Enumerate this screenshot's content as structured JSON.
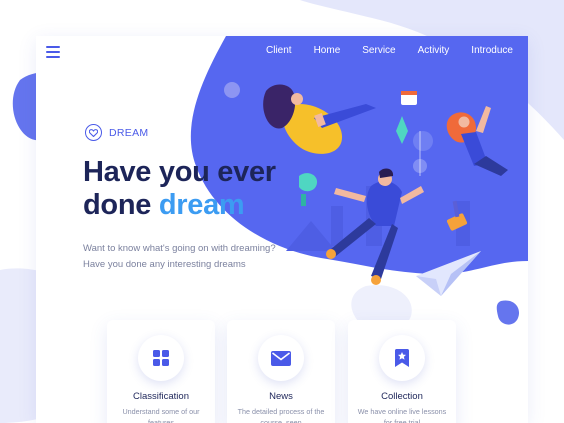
{
  "nav": {
    "menu_icon": "hamburger-menu-icon",
    "links": [
      "Client",
      "Home",
      "Service",
      "Activity",
      "Introduce"
    ]
  },
  "hero": {
    "brand_label": "DREAM",
    "brand_icon": "heart-circle-icon",
    "headline_line1": "Have you ever",
    "headline_line2_plain": "done ",
    "headline_line2_accent": "dream",
    "description": "Want to know what's going on with dreaming? Have you done any interesting dreams"
  },
  "features": [
    {
      "icon": "grid-icon",
      "title": "Classification",
      "desc": "Understand some of our features"
    },
    {
      "icon": "envelope-icon",
      "title": "News",
      "desc": "The detailed process of the course, seen"
    },
    {
      "icon": "bookmark-star-icon",
      "title": "Collection",
      "desc": "We have online live lessons for free trial"
    }
  ],
  "colors": {
    "primary": "#4a5ae8",
    "hero_blue": "#5667f0",
    "accent": "#3c9cf2",
    "headline": "#1d2559",
    "text_muted": "#7b819e",
    "lavender": "#e9ebfb"
  }
}
